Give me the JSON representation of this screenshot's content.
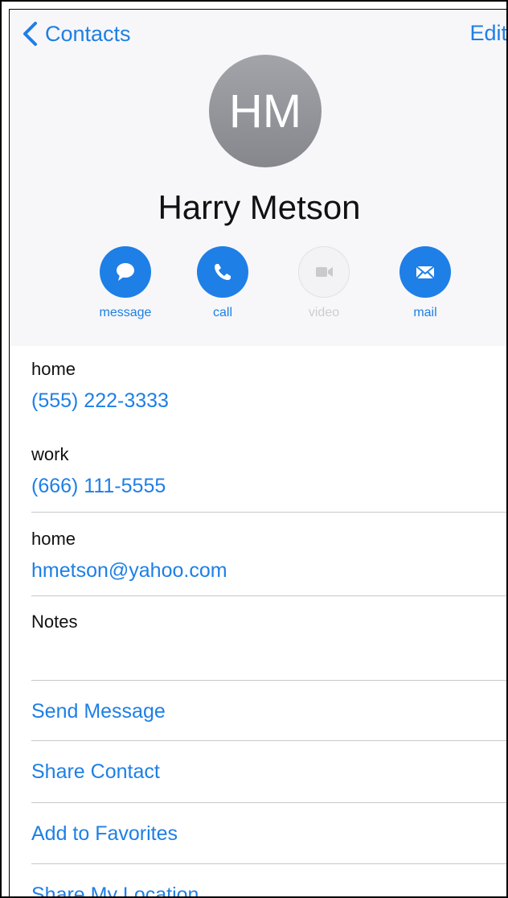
{
  "nav": {
    "back_label": "Contacts",
    "edit_label": "Edit"
  },
  "contact": {
    "initials": "HM",
    "name": "Harry Metson"
  },
  "actions": [
    {
      "label": "message",
      "icon": "message-icon",
      "enabled": true
    },
    {
      "label": "call",
      "icon": "phone-icon",
      "enabled": true
    },
    {
      "label": "video",
      "icon": "video-icon",
      "enabled": false
    },
    {
      "label": "mail",
      "icon": "mail-icon",
      "enabled": true
    }
  ],
  "fields": [
    {
      "label": "home",
      "value": "(555) 222-3333"
    },
    {
      "label": "work",
      "value": "(666) 111-5555"
    },
    {
      "label": "home",
      "value": "hmetson@yahoo.com"
    }
  ],
  "notes": {
    "label": "Notes",
    "value": ""
  },
  "links": [
    "Send Message",
    "Share Contact",
    "Add to Favorites",
    "Share My Location"
  ],
  "colors": {
    "accent": "#1e7fe6",
    "header_bg": "#f7f7f9",
    "avatar": "#9a9ba1",
    "separator": "#c8c8cc"
  }
}
